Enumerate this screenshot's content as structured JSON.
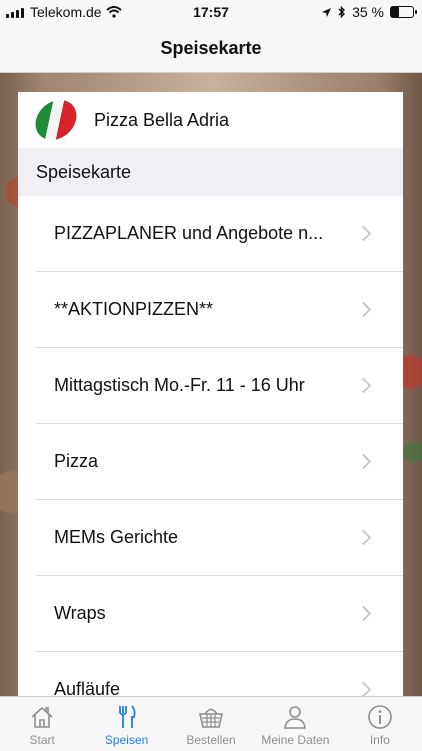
{
  "status_bar": {
    "carrier": "Telekom.de",
    "time": "17:57",
    "battery_percent": "35 %",
    "battery_level": 0.35
  },
  "navbar": {
    "title": "Speisekarte"
  },
  "restaurant": {
    "name": "Pizza Bella Adria"
  },
  "section_header": "Speisekarte",
  "menu": [
    {
      "label": "PIZZAPLANER und Angebote n..."
    },
    {
      "label": "**AKTIONPIZZEN**"
    },
    {
      "label": "Mittagstisch Mo.-Fr. 11 - 16 Uhr"
    },
    {
      "label": "Pizza"
    },
    {
      "label": "MEMs Gerichte"
    },
    {
      "label": "Wraps"
    },
    {
      "label": "Aufläufe"
    }
  ],
  "tabs": [
    {
      "label": "Start",
      "icon": "house-icon"
    },
    {
      "label": "Speisen",
      "icon": "fork-knife-icon"
    },
    {
      "label": "Bestellen",
      "icon": "basket-icon"
    },
    {
      "label": "Meine Daten",
      "icon": "person-icon"
    },
    {
      "label": "Info",
      "icon": "info-icon"
    }
  ],
  "colors": {
    "accent": "#1a7ff0",
    "inactive": "#8e8e93"
  }
}
